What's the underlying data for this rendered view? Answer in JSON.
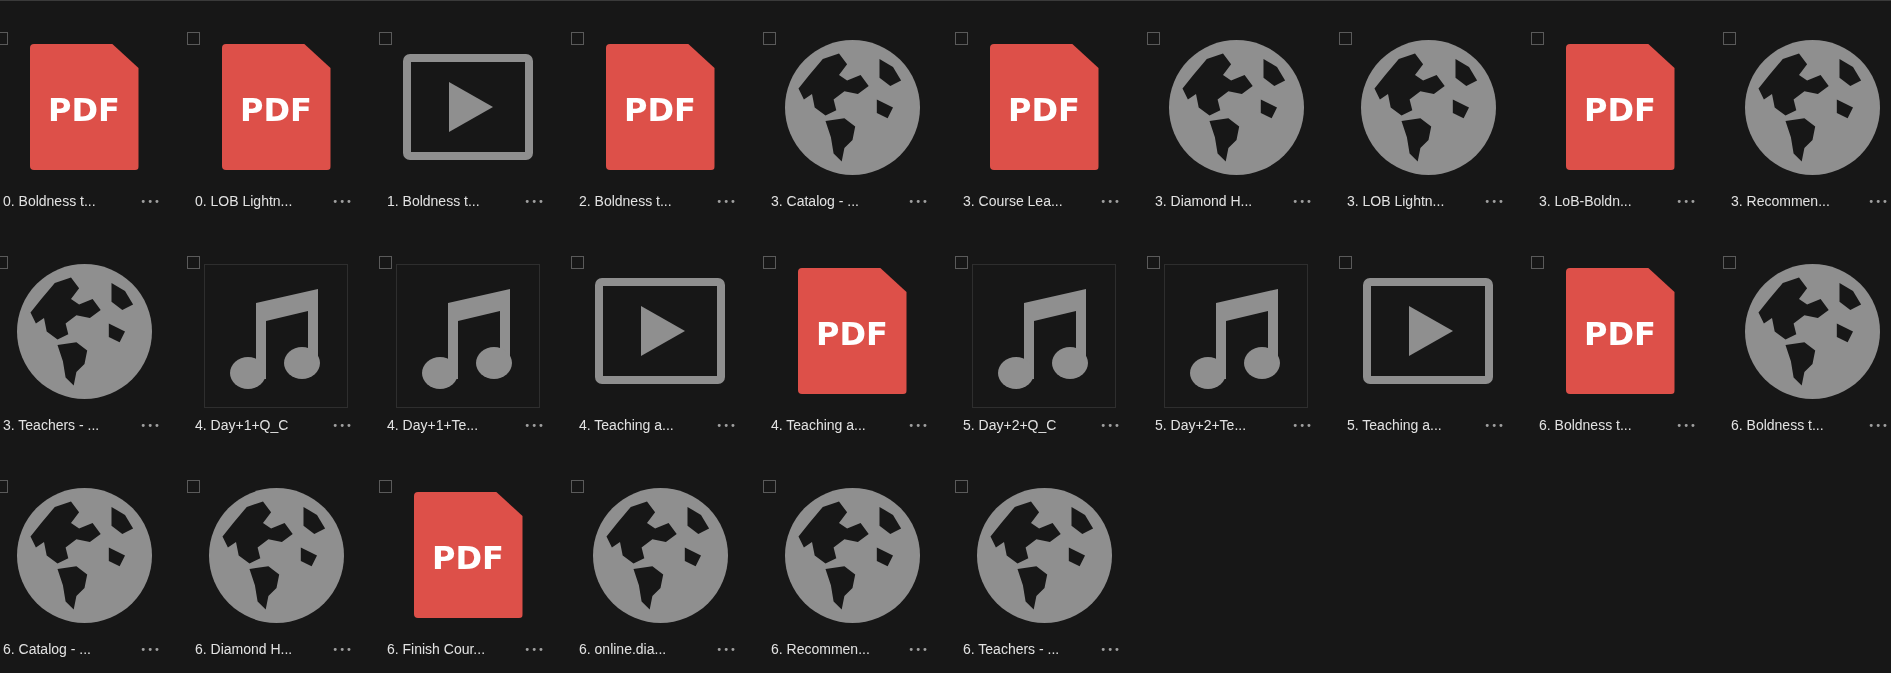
{
  "files": [
    {
      "name": "0. Boldness t...",
      "kind": "pdf",
      "badge": "PDF",
      "more": "•••",
      "checked": false
    },
    {
      "name": "0. LOB Lightn...",
      "kind": "pdf",
      "badge": "PDF",
      "more": "•••",
      "checked": false
    },
    {
      "name": "1. Boldness t...",
      "kind": "video",
      "more": "•••",
      "checked": false
    },
    {
      "name": "2. Boldness t...",
      "kind": "pdf",
      "badge": "PDF",
      "more": "•••",
      "checked": false
    },
    {
      "name": "3. Catalog - ...",
      "kind": "web",
      "more": "•••",
      "checked": false
    },
    {
      "name": "3. Course Lea...",
      "kind": "pdf",
      "badge": "PDF",
      "more": "•••",
      "checked": false
    },
    {
      "name": "3. Diamond H...",
      "kind": "web",
      "more": "•••",
      "checked": false
    },
    {
      "name": "3. LOB Lightn...",
      "kind": "web",
      "more": "•••",
      "checked": false
    },
    {
      "name": "3. LoB-Boldn...",
      "kind": "pdf",
      "badge": "PDF",
      "more": "•••",
      "checked": false
    },
    {
      "name": "3. Recommen...",
      "kind": "web",
      "more": "•••",
      "checked": false
    },
    {
      "name": "3. Teachers - ...",
      "kind": "web",
      "more": "•••",
      "checked": false
    },
    {
      "name": "4. Day+1+Q_C",
      "kind": "audio",
      "more": "•••",
      "checked": false
    },
    {
      "name": "4. Day+1+Te...",
      "kind": "audio",
      "more": "•••",
      "checked": false
    },
    {
      "name": "4. Teaching a...",
      "kind": "video",
      "more": "•••",
      "checked": false
    },
    {
      "name": "4. Teaching a...",
      "kind": "pdf",
      "badge": "PDF",
      "more": "•••",
      "checked": false
    },
    {
      "name": "5. Day+2+Q_C",
      "kind": "audio",
      "more": "•••",
      "checked": false
    },
    {
      "name": "5. Day+2+Te...",
      "kind": "audio",
      "more": "•••",
      "checked": false
    },
    {
      "name": "5. Teaching a...",
      "kind": "video",
      "more": "•••",
      "checked": false
    },
    {
      "name": "6. Boldness t...",
      "kind": "pdf",
      "badge": "PDF",
      "more": "•••",
      "checked": false
    },
    {
      "name": "6. Boldness t...",
      "kind": "web",
      "more": "•••",
      "checked": false
    },
    {
      "name": "6. Catalog - ...",
      "kind": "web",
      "more": "•••",
      "checked": false
    },
    {
      "name": "6. Diamond H...",
      "kind": "web",
      "more": "•••",
      "checked": false
    },
    {
      "name": "6. Finish Cour...",
      "kind": "pdf",
      "badge": "PDF",
      "more": "•••",
      "checked": false
    },
    {
      "name": "6. online.dia...",
      "kind": "web",
      "more": "•••",
      "checked": false
    },
    {
      "name": "6. Recommen...",
      "kind": "web",
      "more": "•••",
      "checked": false
    },
    {
      "name": "6. Teachers - ...",
      "kind": "web",
      "more": "•••",
      "checked": false
    }
  ]
}
